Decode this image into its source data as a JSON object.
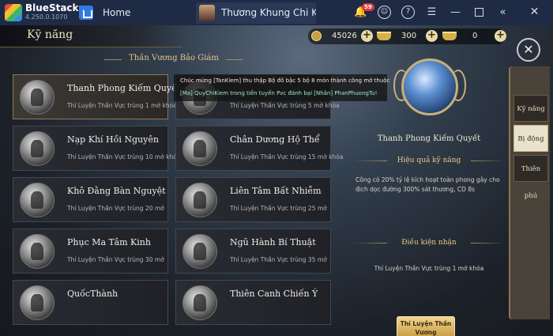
{
  "titlebar": {
    "app_name": "BlueStacks",
    "version": "4.250.0.1070",
    "home_tab": "Home",
    "game_tab": "Thương Khung Chi Ki",
    "notification_count": "59"
  },
  "game": {
    "screen_title": "Kỹ năng",
    "currency": {
      "gold": "45026",
      "ingot": "300",
      "bound_ingot": "0"
    },
    "section_title": "Thần Vương Bảo Giám",
    "skills": [
      {
        "name": "Thanh Phong Kiếm Quyết",
        "req": "Thí Luyện Thần Vực trùng 1 mở khóa",
        "active": true
      },
      {
        "name": "",
        "req": "Thí Luyện Thần Vực trùng 5 mở khóa"
      },
      {
        "name": "Nạp Khí Hồi Nguyên",
        "req": "Thí Luyện Thần Vực trùng 10 mở khóa"
      },
      {
        "name": "Chân Dương Hộ Thể",
        "req": "Thí Luyện Thần Vực trùng 15 mở khóa"
      },
      {
        "name": "Khô Đằng Bàn Nguyệt",
        "req": "Thí Luyện Thần Vực trùng 20 mở"
      },
      {
        "name": "Liên Tâm Bất Nhiễm",
        "req": "Thí Luyện Thần Vực trùng 25 mở"
      },
      {
        "name": "Phục Ma Tâm Kinh",
        "req": "Thí Luyện Thần Vực trùng 30 mở"
      },
      {
        "name": "Ngũ Hành Bí Thuật",
        "req": "Thí Luyện Thần Vực trùng 35 mở"
      },
      {
        "name": "QuốcThành",
        "req": ""
      },
      {
        "name": "Thiên Canh Chiến Ý",
        "req": ""
      }
    ],
    "chat": {
      "line1": "Chúc mừng [TanKiem] thu thập Bộ đồ bậc 5 bộ 8 món thành công mở thuộc",
      "line2": "[Ma] QuyChiKiem trong tiền tuyến Pvc đánh bại [Nhân] PhanPhuongTu!"
    },
    "detail": {
      "name": "Thanh Phong Kiếm Quyết",
      "effect_title": "Hiệu quả kỹ năng",
      "effect_desc": "Công có 20% tỷ lệ kích hoạt toàn phong gây cho địch dọc đường 300% sát thương, CD 8s",
      "cond_title": "Điều kiện nhận",
      "cond_desc": "Thí Luyện Thần Vực trùng 1 mở khóa",
      "button": "Thí Luyện Thần Vương"
    },
    "side_tabs": [
      "Kỹ năng",
      "Bị động",
      "Thiên phú"
    ]
  }
}
